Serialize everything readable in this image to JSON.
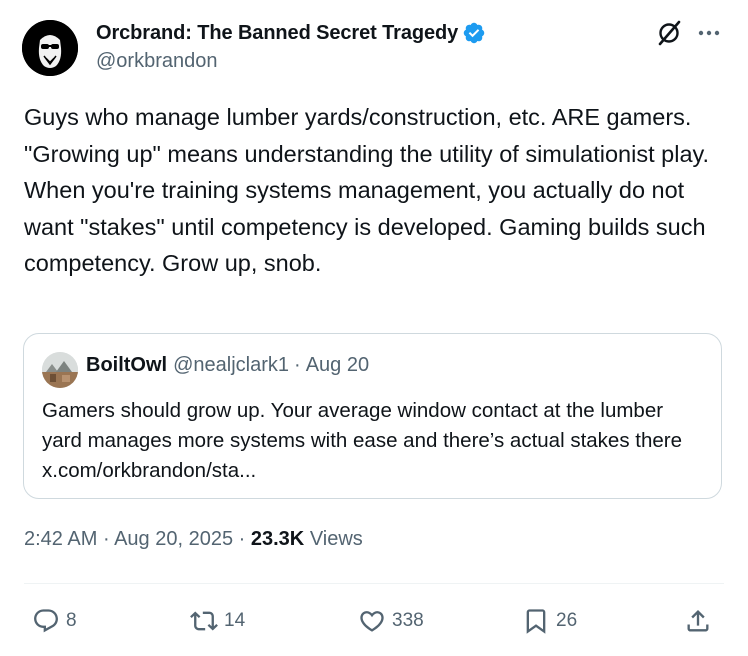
{
  "author": {
    "display_name": "Orcbrand: The Banned Secret Tragedy",
    "handle": "@orkbrandon",
    "verified": true
  },
  "tweet": {
    "text": "Guys who manage lumber yards/construction, etc. ARE gamers. \"Growing up\" means understanding the utility of simulationist play. When you're training systems management, you actually do not want \"stakes\" until competency is developed. Gaming builds such competency. Grow up, snob."
  },
  "quoted_tweet": {
    "display_name": "BoiltOwl",
    "handle": "@nealjclark1",
    "separator": "·",
    "date": "Aug 20",
    "text": "Gamers should grow up. Your average window contact at the lumber yard manages more systems with ease and there’s actual stakes there x.com/orkbrandon/sta..."
  },
  "meta": {
    "time": "2:42 AM",
    "separator": "·",
    "date": "Aug 20, 2025",
    "views_count": "23.3K",
    "views_label": "Views"
  },
  "actions": {
    "replies": "8",
    "retweets": "14",
    "likes": "338",
    "bookmarks": "26"
  },
  "colors": {
    "text": "#0f1419",
    "secondary": "#536471",
    "verified_blue": "#1d9bf0",
    "border": "#cfd9de"
  },
  "icons": [
    "verified-badge-icon",
    "grok-icon",
    "more-icon",
    "reply-icon",
    "retweet-icon",
    "like-icon",
    "bookmark-icon",
    "share-icon"
  ]
}
